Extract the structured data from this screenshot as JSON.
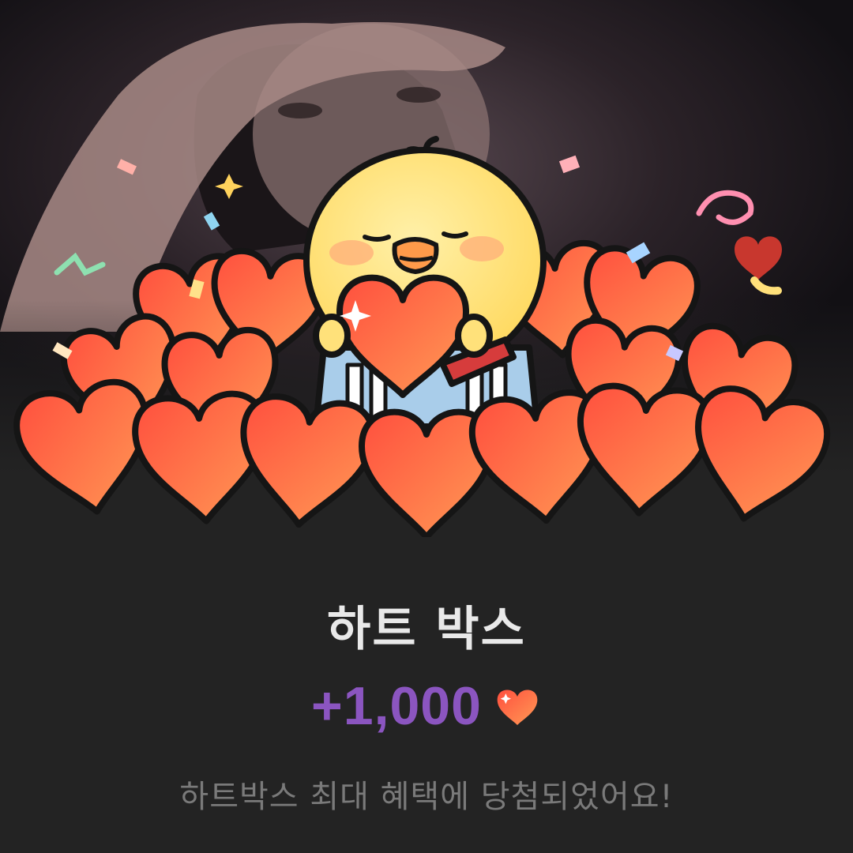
{
  "popup": {
    "title": "하트 박스",
    "reward_amount": "+1,000",
    "reward_icon": "heart-icon",
    "message": "하트박스 최대 혜택에 당첨되었어요!"
  },
  "colors": {
    "background": "#232323",
    "title_text": "#e9e9e9",
    "reward_text": "#8b55c0",
    "message_text": "#7a7a7a",
    "heart_fill_light": "#ff9a55",
    "heart_fill_dark": "#ff4f3e",
    "chick_yellow": "#ffe17a"
  }
}
